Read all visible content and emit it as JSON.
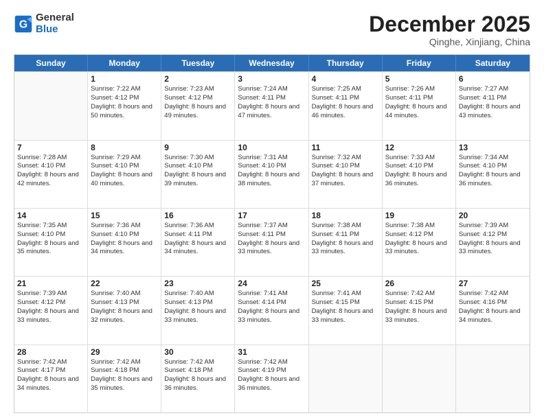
{
  "logo": {
    "general": "General",
    "blue": "Blue"
  },
  "title": {
    "month_year": "December 2025",
    "location": "Qinghe, Xinjiang, China"
  },
  "header_days": [
    "Sunday",
    "Monday",
    "Tuesday",
    "Wednesday",
    "Thursday",
    "Friday",
    "Saturday"
  ],
  "weeks": [
    [
      {
        "day": "",
        "sunrise": "",
        "sunset": "",
        "daylight": "",
        "empty": true
      },
      {
        "day": "1",
        "sunrise": "Sunrise: 7:22 AM",
        "sunset": "Sunset: 4:12 PM",
        "daylight": "Daylight: 8 hours and 50 minutes.",
        "empty": false
      },
      {
        "day": "2",
        "sunrise": "Sunrise: 7:23 AM",
        "sunset": "Sunset: 4:12 PM",
        "daylight": "Daylight: 8 hours and 49 minutes.",
        "empty": false
      },
      {
        "day": "3",
        "sunrise": "Sunrise: 7:24 AM",
        "sunset": "Sunset: 4:11 PM",
        "daylight": "Daylight: 8 hours and 47 minutes.",
        "empty": false
      },
      {
        "day": "4",
        "sunrise": "Sunrise: 7:25 AM",
        "sunset": "Sunset: 4:11 PM",
        "daylight": "Daylight: 8 hours and 46 minutes.",
        "empty": false
      },
      {
        "day": "5",
        "sunrise": "Sunrise: 7:26 AM",
        "sunset": "Sunset: 4:11 PM",
        "daylight": "Daylight: 8 hours and 44 minutes.",
        "empty": false
      },
      {
        "day": "6",
        "sunrise": "Sunrise: 7:27 AM",
        "sunset": "Sunset: 4:11 PM",
        "daylight": "Daylight: 8 hours and 43 minutes.",
        "empty": false
      }
    ],
    [
      {
        "day": "7",
        "sunrise": "Sunrise: 7:28 AM",
        "sunset": "Sunset: 4:10 PM",
        "daylight": "Daylight: 8 hours and 42 minutes.",
        "empty": false
      },
      {
        "day": "8",
        "sunrise": "Sunrise: 7:29 AM",
        "sunset": "Sunset: 4:10 PM",
        "daylight": "Daylight: 8 hours and 40 minutes.",
        "empty": false
      },
      {
        "day": "9",
        "sunrise": "Sunrise: 7:30 AM",
        "sunset": "Sunset: 4:10 PM",
        "daylight": "Daylight: 8 hours and 39 minutes.",
        "empty": false
      },
      {
        "day": "10",
        "sunrise": "Sunrise: 7:31 AM",
        "sunset": "Sunset: 4:10 PM",
        "daylight": "Daylight: 8 hours and 38 minutes.",
        "empty": false
      },
      {
        "day": "11",
        "sunrise": "Sunrise: 7:32 AM",
        "sunset": "Sunset: 4:10 PM",
        "daylight": "Daylight: 8 hours and 37 minutes.",
        "empty": false
      },
      {
        "day": "12",
        "sunrise": "Sunrise: 7:33 AM",
        "sunset": "Sunset: 4:10 PM",
        "daylight": "Daylight: 8 hours and 36 minutes.",
        "empty": false
      },
      {
        "day": "13",
        "sunrise": "Sunrise: 7:34 AM",
        "sunset": "Sunset: 4:10 PM",
        "daylight": "Daylight: 8 hours and 36 minutes.",
        "empty": false
      }
    ],
    [
      {
        "day": "14",
        "sunrise": "Sunrise: 7:35 AM",
        "sunset": "Sunset: 4:10 PM",
        "daylight": "Daylight: 8 hours and 35 minutes.",
        "empty": false
      },
      {
        "day": "15",
        "sunrise": "Sunrise: 7:36 AM",
        "sunset": "Sunset: 4:10 PM",
        "daylight": "Daylight: 8 hours and 34 minutes.",
        "empty": false
      },
      {
        "day": "16",
        "sunrise": "Sunrise: 7:36 AM",
        "sunset": "Sunset: 4:11 PM",
        "daylight": "Daylight: 8 hours and 34 minutes.",
        "empty": false
      },
      {
        "day": "17",
        "sunrise": "Sunrise: 7:37 AM",
        "sunset": "Sunset: 4:11 PM",
        "daylight": "Daylight: 8 hours and 33 minutes.",
        "empty": false
      },
      {
        "day": "18",
        "sunrise": "Sunrise: 7:38 AM",
        "sunset": "Sunset: 4:11 PM",
        "daylight": "Daylight: 8 hours and 33 minutes.",
        "empty": false
      },
      {
        "day": "19",
        "sunrise": "Sunrise: 7:38 AM",
        "sunset": "Sunset: 4:12 PM",
        "daylight": "Daylight: 8 hours and 33 minutes.",
        "empty": false
      },
      {
        "day": "20",
        "sunrise": "Sunrise: 7:39 AM",
        "sunset": "Sunset: 4:12 PM",
        "daylight": "Daylight: 8 hours and 33 minutes.",
        "empty": false
      }
    ],
    [
      {
        "day": "21",
        "sunrise": "Sunrise: 7:39 AM",
        "sunset": "Sunset: 4:12 PM",
        "daylight": "Daylight: 8 hours and 33 minutes.",
        "empty": false
      },
      {
        "day": "22",
        "sunrise": "Sunrise: 7:40 AM",
        "sunset": "Sunset: 4:13 PM",
        "daylight": "Daylight: 8 hours and 32 minutes.",
        "empty": false
      },
      {
        "day": "23",
        "sunrise": "Sunrise: 7:40 AM",
        "sunset": "Sunset: 4:13 PM",
        "daylight": "Daylight: 8 hours and 33 minutes.",
        "empty": false
      },
      {
        "day": "24",
        "sunrise": "Sunrise: 7:41 AM",
        "sunset": "Sunset: 4:14 PM",
        "daylight": "Daylight: 8 hours and 33 minutes.",
        "empty": false
      },
      {
        "day": "25",
        "sunrise": "Sunrise: 7:41 AM",
        "sunset": "Sunset: 4:15 PM",
        "daylight": "Daylight: 8 hours and 33 minutes.",
        "empty": false
      },
      {
        "day": "26",
        "sunrise": "Sunrise: 7:42 AM",
        "sunset": "Sunset: 4:15 PM",
        "daylight": "Daylight: 8 hours and 33 minutes.",
        "empty": false
      },
      {
        "day": "27",
        "sunrise": "Sunrise: 7:42 AM",
        "sunset": "Sunset: 4:16 PM",
        "daylight": "Daylight: 8 hours and 34 minutes.",
        "empty": false
      }
    ],
    [
      {
        "day": "28",
        "sunrise": "Sunrise: 7:42 AM",
        "sunset": "Sunset: 4:17 PM",
        "daylight": "Daylight: 8 hours and 34 minutes.",
        "empty": false
      },
      {
        "day": "29",
        "sunrise": "Sunrise: 7:42 AM",
        "sunset": "Sunset: 4:18 PM",
        "daylight": "Daylight: 8 hours and 35 minutes.",
        "empty": false
      },
      {
        "day": "30",
        "sunrise": "Sunrise: 7:42 AM",
        "sunset": "Sunset: 4:18 PM",
        "daylight": "Daylight: 8 hours and 36 minutes.",
        "empty": false
      },
      {
        "day": "31",
        "sunrise": "Sunrise: 7:42 AM",
        "sunset": "Sunset: 4:19 PM",
        "daylight": "Daylight: 8 hours and 36 minutes.",
        "empty": false
      },
      {
        "day": "",
        "sunrise": "",
        "sunset": "",
        "daylight": "",
        "empty": true
      },
      {
        "day": "",
        "sunrise": "",
        "sunset": "",
        "daylight": "",
        "empty": true
      },
      {
        "day": "",
        "sunrise": "",
        "sunset": "",
        "daylight": "",
        "empty": true
      }
    ]
  ]
}
